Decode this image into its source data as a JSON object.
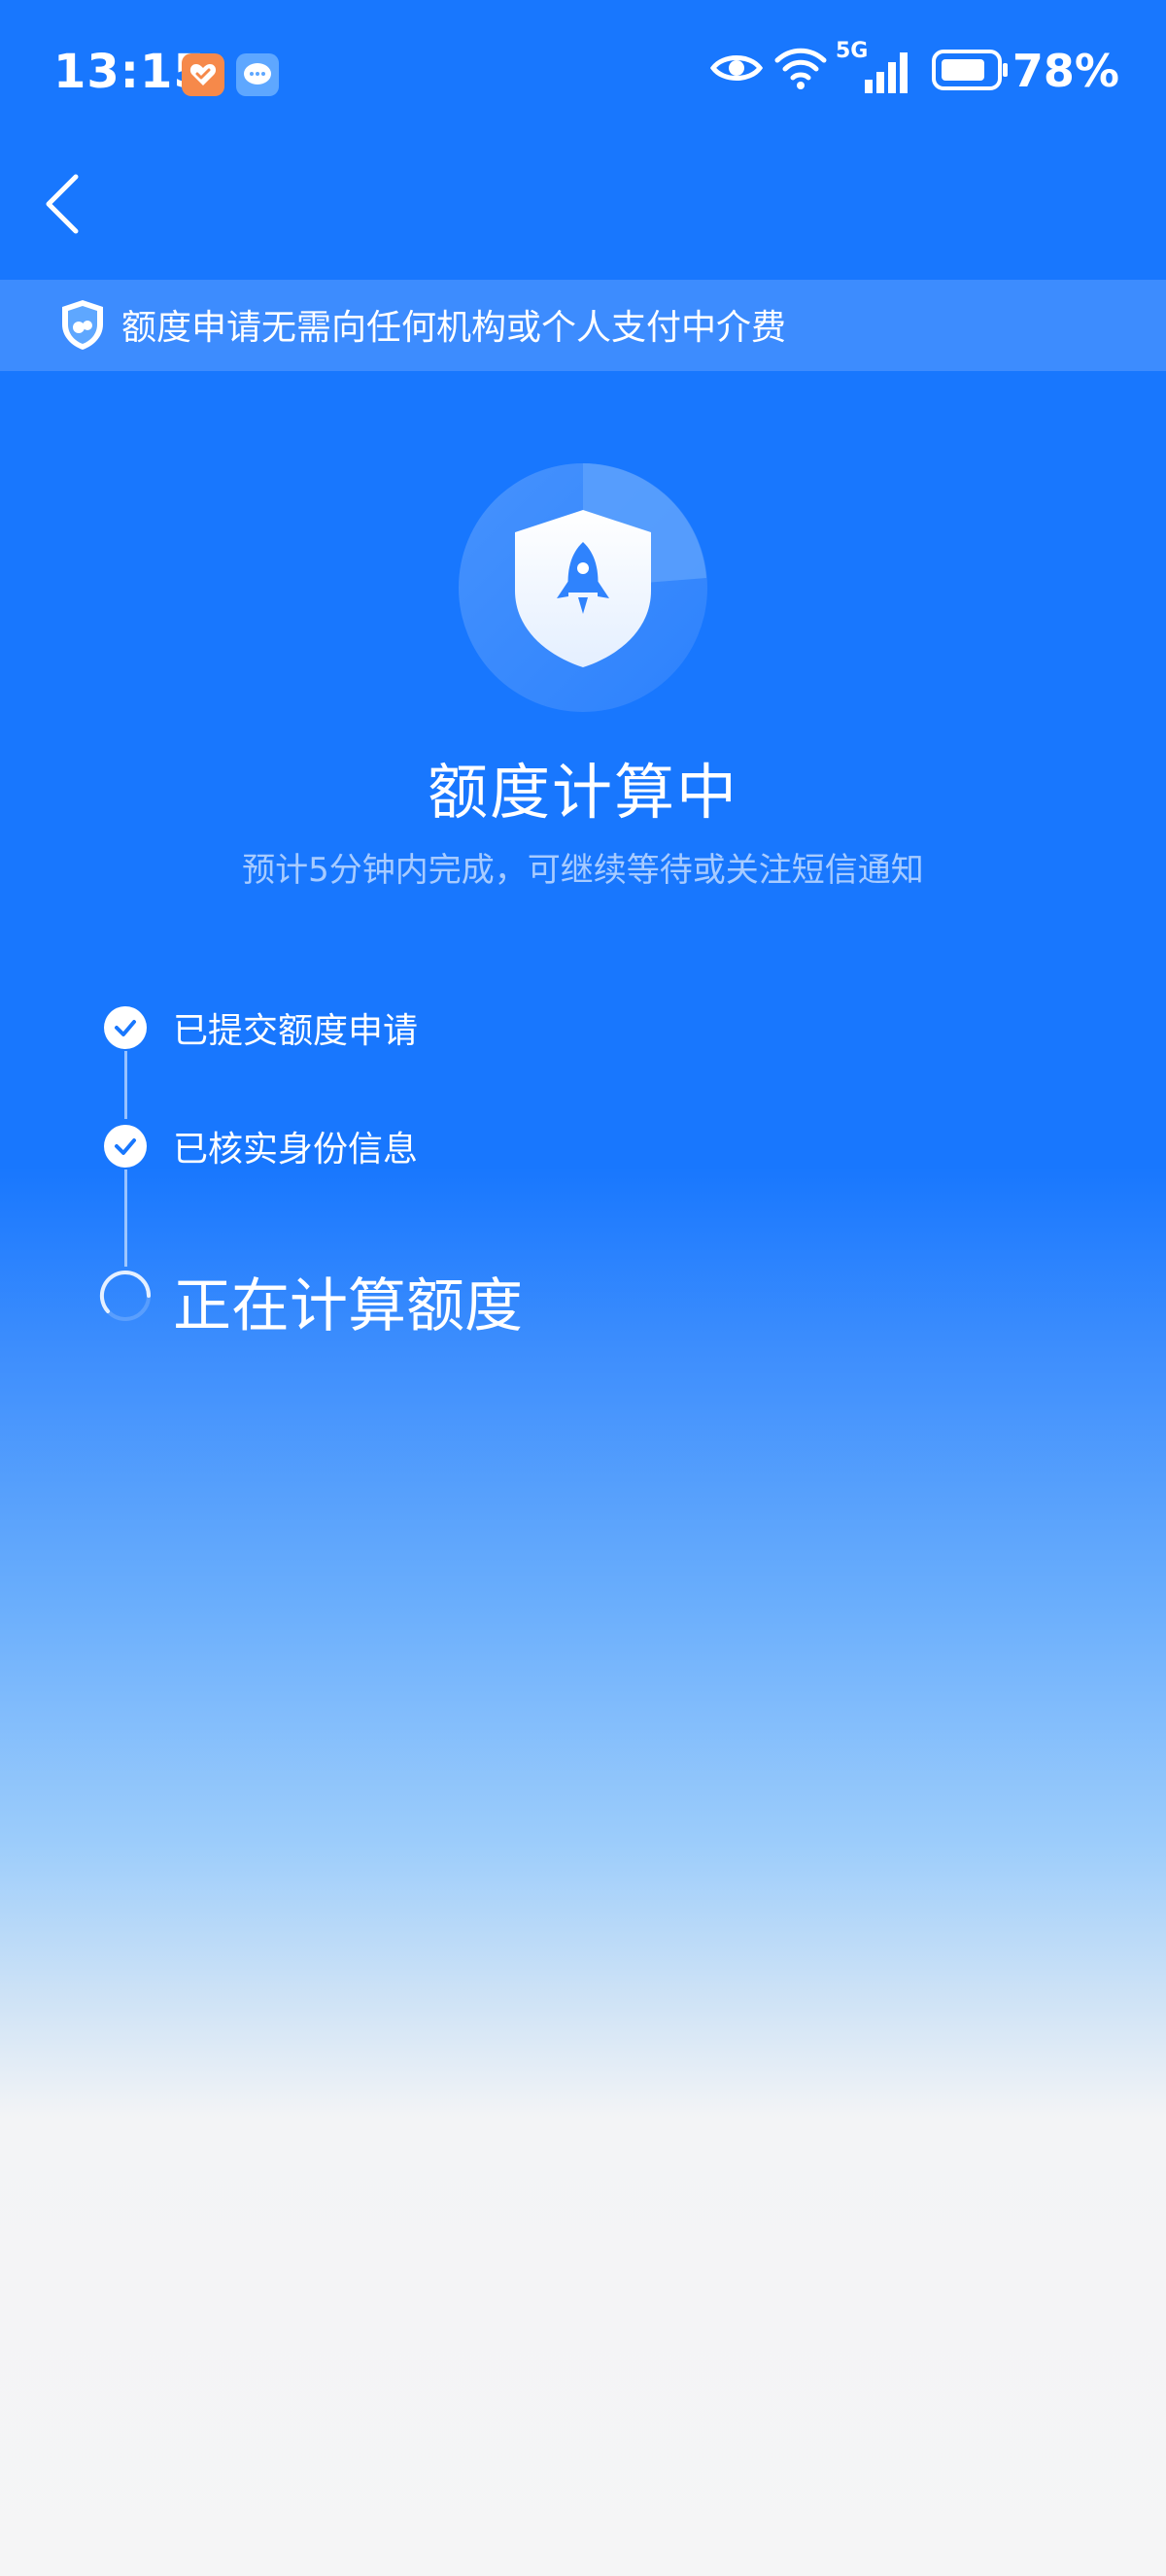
{
  "status_bar": {
    "time": "13:15",
    "network": "5G",
    "battery": "78%"
  },
  "colors": {
    "primary": "#1877fe",
    "bottom": "#f5f5f6"
  },
  "notice": {
    "text": "额度申请无需向任何机构或个人支付中介费"
  },
  "hero": {
    "title": "额度计算中",
    "subtitle": "预计5分钟内完成，可继续等待或关注短信通知"
  },
  "steps": [
    {
      "label": "已提交额度申请",
      "status": "done"
    },
    {
      "label": "已核实身份信息",
      "status": "done"
    },
    {
      "label": "正在计算额度",
      "status": "in-progress"
    }
  ]
}
